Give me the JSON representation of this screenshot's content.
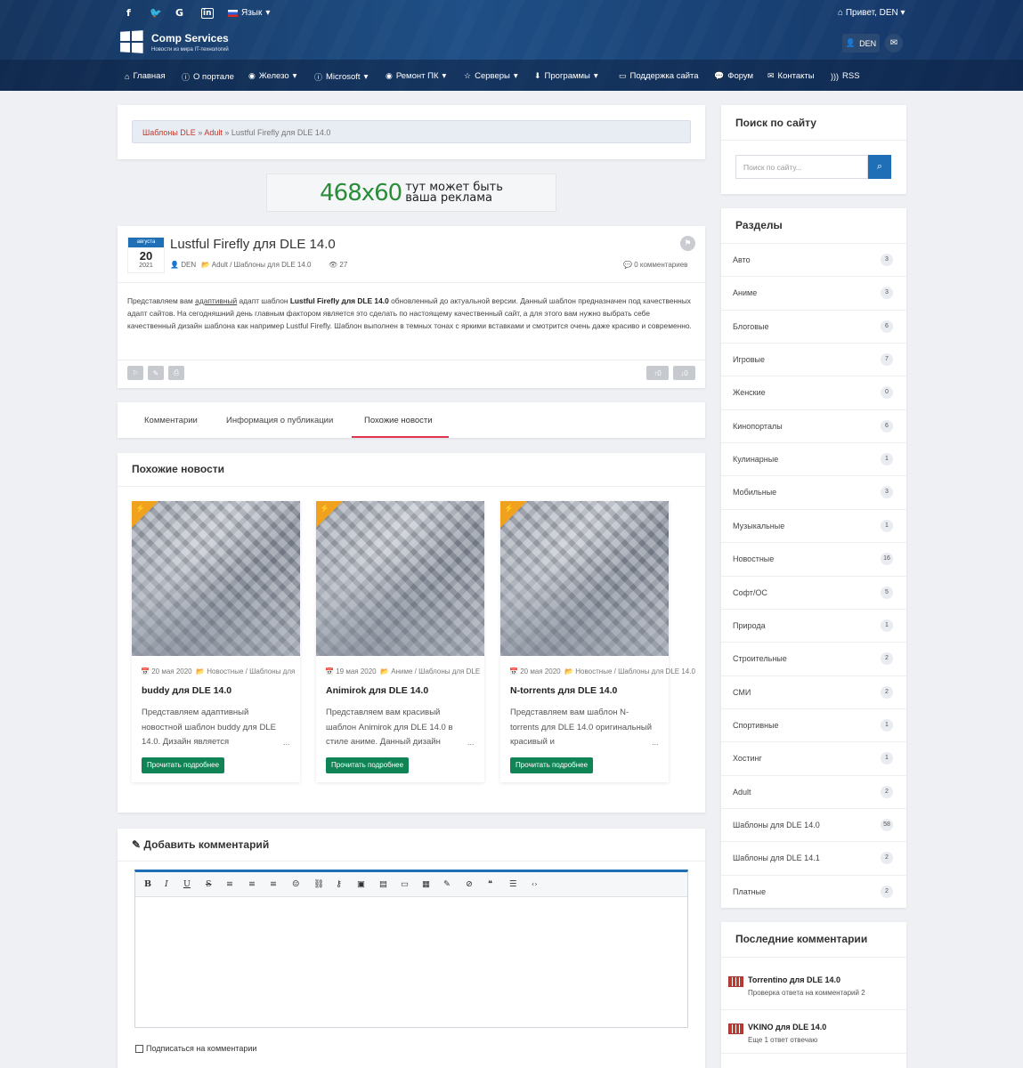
{
  "topbar": {
    "social": [
      "f",
      "t",
      "G",
      "in"
    ],
    "lang_label": "Язык",
    "greeting": "Привет, DEN"
  },
  "brand": {
    "title": "Comp Services",
    "subtitle": "Новости из мира IT-технологий"
  },
  "user": {
    "name": "DEN"
  },
  "nav": {
    "items": [
      {
        "label": "Главная",
        "icon": "home-icon"
      },
      {
        "label": "О портале",
        "icon": "info-icon"
      },
      {
        "label": "Железо",
        "icon": "globe-icon",
        "dropdown": true
      },
      {
        "label": "Microsoft",
        "icon": "globe-icon",
        "dropdown": true
      },
      {
        "label": "Программы",
        "icon": "info-icon",
        "dropdown": true
      },
      {
        "label": "Ремонт ПК",
        "icon": "globe-icon",
        "dropdown": true
      },
      {
        "label": "Серверы",
        "icon": "star-icon",
        "dropdown": true
      },
      {
        "label": "Программы",
        "icon": "download-icon",
        "dropdown": true
      },
      {
        "label": "Поддержка сайта",
        "icon": "card-icon"
      },
      {
        "label": "Форум",
        "icon": "chat-icon"
      },
      {
        "label": "Контакты",
        "icon": "mail-icon"
      },
      {
        "label": "RSS",
        "icon": "rss-icon"
      }
    ]
  },
  "breadcrumb": {
    "items": [
      "Шаблоны DLE",
      "Adult"
    ],
    "separator": "»",
    "current": "Lustful Firefly для DLE 14.0"
  },
  "banner": {
    "size": "468x60",
    "line1": "тут может быть",
    "line2": "ваша реклама"
  },
  "article": {
    "date": {
      "month": "августа",
      "day": "20",
      "year": "2021"
    },
    "title": "Lustful Firefly для DLE 14.0",
    "author": "DEN",
    "category": "Adult / Шаблоны для DLE 14.0",
    "views": "27",
    "comments": "0 комментариев",
    "body_prefix": "Представляем вам ",
    "body_link": "адаптивный",
    "body_mid": " адапт шаблон ",
    "body_bold": "Lustful Firefly для DLE 14.0",
    "body_rest": " обновленный до актуальной версии. Данный шаблон предназначен под качественных адапт сайтов. На сегодняшний день главным фактором является это сделать по настоящему качественный сайт, а для этого вам нужно выбрать себе качественный дизайн шаблона как например Lustful Firefly. Шаблон выполнен в темных тонах с яркими вставками и смотрится очень даже красиво и современно.",
    "vote_up": "0",
    "vote_down": "0"
  },
  "tabs": [
    "Комментарии",
    "Информация о публикации",
    "Похожие новости"
  ],
  "related": {
    "heading": "Похожие новости",
    "read_more": "Прочитать подробнее",
    "items": [
      {
        "date": "20 мая 2020",
        "category": "Новостные / Шаблоны для",
        "title": "buddy для DLE 14.0",
        "text": "Представляем адаптивный новостной шаблон buddy для DLE 14.0. Дизайн является"
      },
      {
        "date": "19 мая 2020",
        "category": "Аниме / Шаблоны для DLE",
        "title": "Animirok для DLE 14.0",
        "text": "Представляем вам красивый шаблон Animirok для DLE 14.0 в стиле аниме. Данный дизайн"
      },
      {
        "date": "20 мая 2020",
        "category": "Новостные / Шаблоны для DLE 14.0",
        "title": "N-torrents для DLE 14.0",
        "text": "Представляем вам шаблон N-torrents для DLE 14.0 оригинальный красивый и"
      }
    ]
  },
  "comment_form": {
    "heading": "Добавить комментарий",
    "toolbar": [
      "B",
      "I",
      "U",
      "S",
      "≡",
      "≡",
      "≡",
      "☺",
      "⛓",
      "⚷",
      "▣",
      "▤",
      "▭",
      "▦",
      "✎",
      "⊘",
      "❝",
      "☰",
      "‹›"
    ],
    "subscribe_label": "Подписаться на комментарии"
  },
  "sidebar": {
    "search": {
      "heading": "Поиск по сайту",
      "placeholder": "Поиск по сайту..."
    },
    "sections": {
      "heading": "Разделы",
      "items": [
        {
          "name": "Авто",
          "count": "3"
        },
        {
          "name": "Аниме",
          "count": "3"
        },
        {
          "name": "Блоговые",
          "count": "6"
        },
        {
          "name": "Игровые",
          "count": "7"
        },
        {
          "name": "Женские",
          "count": "0"
        },
        {
          "name": "Кинопорталы",
          "count": "6"
        },
        {
          "name": "Кулинарные",
          "count": "1"
        },
        {
          "name": "Мобильные",
          "count": "3"
        },
        {
          "name": "Музыкальные",
          "count": "1"
        },
        {
          "name": "Новостные",
          "count": "16"
        },
        {
          "name": "Софт/ОС",
          "count": "5"
        },
        {
          "name": "Природа",
          "count": "1"
        },
        {
          "name": "Строительные",
          "count": "2"
        },
        {
          "name": "СМИ",
          "count": "2"
        },
        {
          "name": "Спортивные",
          "count": "1"
        },
        {
          "name": "Хостинг",
          "count": "1"
        },
        {
          "name": "Adult",
          "count": "2"
        },
        {
          "name": "Шаблоны для DLE 14.0",
          "count": "58"
        },
        {
          "name": "Шаблоны для DLE 14.1",
          "count": "2"
        },
        {
          "name": "Платные",
          "count": "2"
        }
      ]
    },
    "last_comments": {
      "heading": "Последние комментарии",
      "items": [
        {
          "title": "Torrentino для DLE 14.0",
          "text": "Проверка ответа на комментарий 2"
        },
        {
          "title": "VKINO для DLE 14.0",
          "text": "Еще 1 ответ отвечаю"
        }
      ]
    }
  }
}
